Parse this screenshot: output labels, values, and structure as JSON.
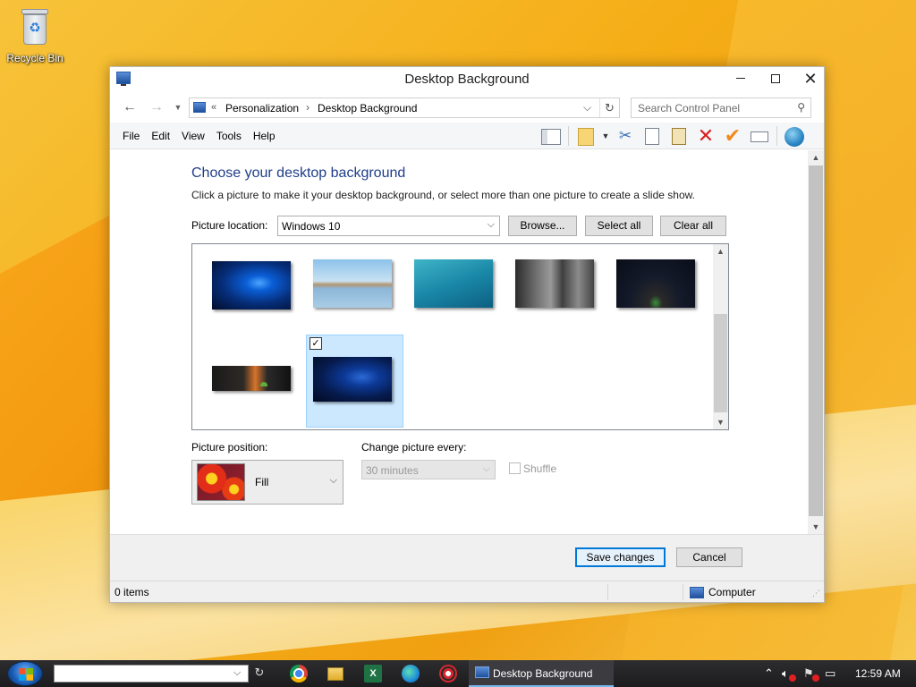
{
  "desktop": {
    "recycle_bin_label": "Recycle Bin"
  },
  "window": {
    "title": "Desktop Background",
    "address": {
      "chevron": "«",
      "crumb_1": "Personalization",
      "separator": "›",
      "crumb_2": "Desktop Background"
    },
    "search": {
      "placeholder": "Search Control Panel"
    },
    "menu": {
      "file": "File",
      "edit": "Edit",
      "view": "View",
      "tools": "Tools",
      "help": "Help"
    }
  },
  "content": {
    "heading": "Choose your desktop background",
    "subtext": "Click a picture to make it your desktop background, or select more than one picture to create a slide show.",
    "picture_location_label": "Picture location:",
    "picture_location_value": "Windows 10",
    "browse_label": "Browse...",
    "select_all_label": "Select all",
    "clear_all_label": "Clear all",
    "selected_check": "✓",
    "picture_position_label": "Picture position:",
    "picture_position_value": "Fill",
    "change_picture_label": "Change picture every:",
    "change_picture_value": "30 minutes",
    "shuffle_label": "Shuffle"
  },
  "footer": {
    "save_label": "Save changes",
    "cancel_label": "Cancel"
  },
  "statusbar": {
    "items": "0 items",
    "location": "Computer"
  },
  "taskbar": {
    "excel_glyph": "X",
    "active_task": "Desktop Background",
    "clock": "12:59 AM"
  },
  "colors": {
    "heading": "#1e3d8a",
    "accent": "#0078d7",
    "selection": "#cce8ff"
  }
}
